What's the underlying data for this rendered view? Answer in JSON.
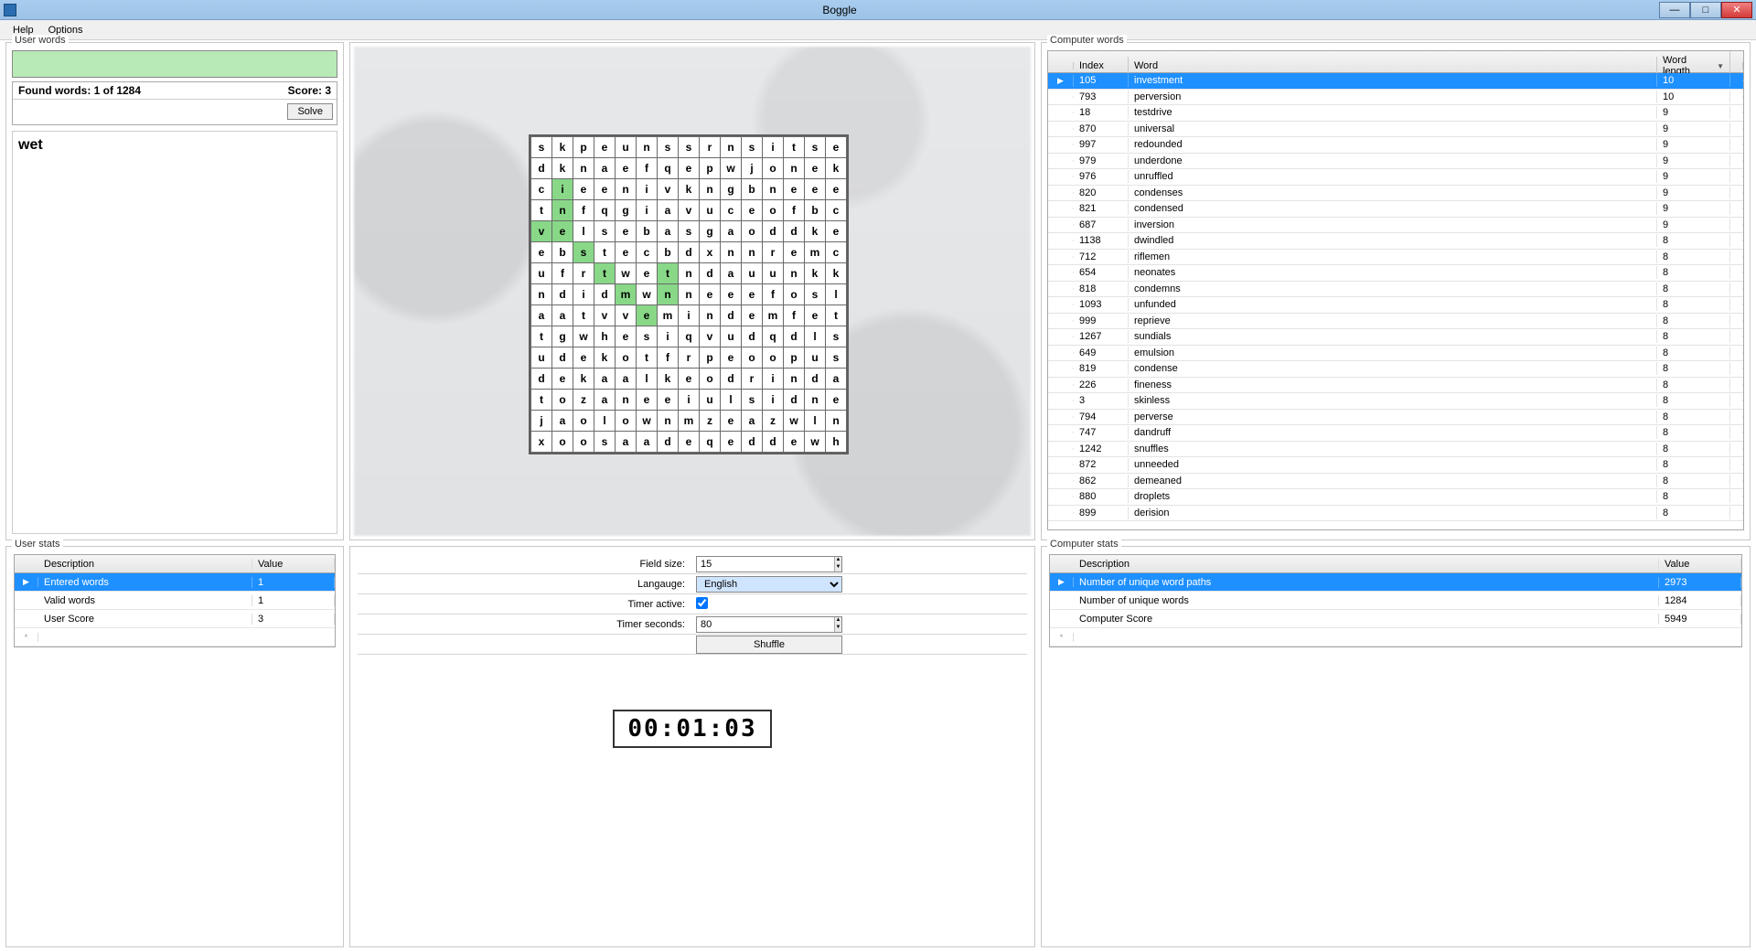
{
  "window": {
    "title": "Boggle"
  },
  "menu": {
    "help": "Help",
    "options": "Options"
  },
  "panels": {
    "user_words": "User words",
    "computer_words": "Computer words",
    "user_stats": "User stats",
    "computer_stats": "Computer stats"
  },
  "user": {
    "found_label": "Found words: 1 of 1284",
    "score_label": "Score: 3",
    "solve_btn": "Solve",
    "entered": [
      "wet"
    ]
  },
  "board": {
    "size": 15,
    "letters": [
      [
        "s",
        "k",
        "p",
        "e",
        "u",
        "n",
        "s",
        "s",
        "r",
        "n",
        "s",
        "i",
        "t",
        "s",
        "e"
      ],
      [
        "d",
        "k",
        "n",
        "a",
        "e",
        "f",
        "q",
        "e",
        "p",
        "w",
        "j",
        "o",
        "n",
        "e",
        "k"
      ],
      [
        "c",
        "i",
        "e",
        "e",
        "n",
        "i",
        "v",
        "k",
        "n",
        "g",
        "b",
        "n",
        "e",
        "e",
        "e"
      ],
      [
        "t",
        "n",
        "f",
        "q",
        "g",
        "i",
        "a",
        "v",
        "u",
        "c",
        "e",
        "o",
        "f",
        "b",
        "c"
      ],
      [
        "v",
        "e",
        "l",
        "s",
        "e",
        "b",
        "a",
        "s",
        "g",
        "a",
        "o",
        "d",
        "d",
        "k",
        "e"
      ],
      [
        "e",
        "b",
        "s",
        "t",
        "e",
        "c",
        "b",
        "d",
        "x",
        "n",
        "n",
        "r",
        "e",
        "m",
        "c"
      ],
      [
        "u",
        "f",
        "r",
        "t",
        "w",
        "e",
        "t",
        "n",
        "d",
        "a",
        "u",
        "u",
        "n",
        "k",
        "k"
      ],
      [
        "n",
        "d",
        "i",
        "d",
        "m",
        "w",
        "n",
        "n",
        "e",
        "e",
        "e",
        "f",
        "o",
        "s",
        "l"
      ],
      [
        "a",
        "a",
        "t",
        "v",
        "v",
        "e",
        "m",
        "i",
        "n",
        "d",
        "e",
        "m",
        "f",
        "e",
        "t"
      ],
      [
        "t",
        "g",
        "w",
        "h",
        "e",
        "s",
        "i",
        "q",
        "v",
        "u",
        "d",
        "q",
        "d",
        "l",
        "s"
      ],
      [
        "u",
        "d",
        "e",
        "k",
        "o",
        "t",
        "f",
        "r",
        "p",
        "e",
        "o",
        "o",
        "p",
        "u",
        "s"
      ],
      [
        "d",
        "e",
        "k",
        "a",
        "a",
        "l",
        "k",
        "e",
        "o",
        "d",
        "r",
        "i",
        "n",
        "d",
        "a"
      ],
      [
        "t",
        "o",
        "z",
        "a",
        "n",
        "e",
        "e",
        "i",
        "u",
        "l",
        "s",
        "i",
        "d",
        "n",
        "e"
      ],
      [
        "j",
        "a",
        "o",
        "l",
        "o",
        "w",
        "n",
        "m",
        "z",
        "e",
        "a",
        "z",
        "w",
        "l",
        "n"
      ],
      [
        "x",
        "o",
        "o",
        "s",
        "a",
        "a",
        "d",
        "e",
        "q",
        "e",
        "d",
        "d",
        "e",
        "w",
        "h"
      ]
    ],
    "highlights": [
      [
        2,
        1
      ],
      [
        3,
        1
      ],
      [
        4,
        0
      ],
      [
        4,
        1
      ],
      [
        5,
        2
      ],
      [
        6,
        3
      ],
      [
        6,
        6
      ],
      [
        7,
        4
      ],
      [
        7,
        6
      ],
      [
        8,
        5
      ]
    ]
  },
  "computer_words": {
    "columns": {
      "index": "Index",
      "word": "Word",
      "length": "Word length"
    },
    "rows": [
      {
        "index": 105,
        "word": "investment",
        "len": 10,
        "selected": true
      },
      {
        "index": 793,
        "word": "perversion",
        "len": 10
      },
      {
        "index": 18,
        "word": "testdrive",
        "len": 9
      },
      {
        "index": 870,
        "word": "universal",
        "len": 9
      },
      {
        "index": 997,
        "word": "redounded",
        "len": 9
      },
      {
        "index": 979,
        "word": "underdone",
        "len": 9
      },
      {
        "index": 976,
        "word": "unruffled",
        "len": 9
      },
      {
        "index": 820,
        "word": "condenses",
        "len": 9
      },
      {
        "index": 821,
        "word": "condensed",
        "len": 9
      },
      {
        "index": 687,
        "word": "inversion",
        "len": 9
      },
      {
        "index": 1138,
        "word": "dwindled",
        "len": 8
      },
      {
        "index": 712,
        "word": "riflemen",
        "len": 8
      },
      {
        "index": 654,
        "word": "neonates",
        "len": 8
      },
      {
        "index": 818,
        "word": "condemns",
        "len": 8
      },
      {
        "index": 1093,
        "word": "unfunded",
        "len": 8
      },
      {
        "index": 999,
        "word": "reprieve",
        "len": 8
      },
      {
        "index": 1267,
        "word": "sundials",
        "len": 8
      },
      {
        "index": 649,
        "word": "emulsion",
        "len": 8
      },
      {
        "index": 819,
        "word": "condense",
        "len": 8
      },
      {
        "index": 226,
        "word": "fineness",
        "len": 8
      },
      {
        "index": 3,
        "word": "skinless",
        "len": 8
      },
      {
        "index": 794,
        "word": "perverse",
        "len": 8
      },
      {
        "index": 747,
        "word": "dandruff",
        "len": 8
      },
      {
        "index": 1242,
        "word": "snuffles",
        "len": 8
      },
      {
        "index": 872,
        "word": "unneeded",
        "len": 8
      },
      {
        "index": 862,
        "word": "demeaned",
        "len": 8
      },
      {
        "index": 880,
        "word": "droplets",
        "len": 8
      },
      {
        "index": 899,
        "word": "derision",
        "len": 8
      }
    ]
  },
  "controls": {
    "field_size_lbl": "Field size:",
    "field_size_val": "15",
    "language_lbl": "Langauge:",
    "language_val": "English",
    "timer_active_lbl": "Timer active:",
    "timer_active_val": true,
    "timer_seconds_lbl": "Timer seconds:",
    "timer_seconds_val": "80",
    "shuffle_btn": "Shuffle",
    "timer_display": "00:01:03"
  },
  "user_stats": {
    "columns": {
      "desc": "Description",
      "val": "Value"
    },
    "rows": [
      {
        "desc": "Entered words",
        "val": "1",
        "selected": true
      },
      {
        "desc": "Valid words",
        "val": "1"
      },
      {
        "desc": "User Score",
        "val": "3"
      }
    ]
  },
  "comp_stats": {
    "columns": {
      "desc": "Description",
      "val": "Value"
    },
    "rows": [
      {
        "desc": "Number of unique word paths",
        "val": "2973",
        "selected": true
      },
      {
        "desc": "Number of unique words",
        "val": "1284"
      },
      {
        "desc": "Computer Score",
        "val": "5949"
      }
    ]
  }
}
